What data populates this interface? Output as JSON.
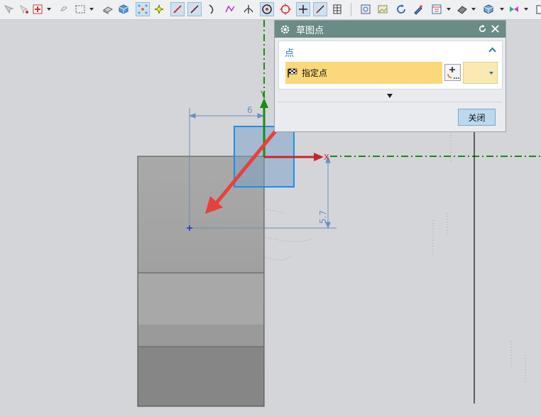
{
  "dialog": {
    "title": "草图点",
    "section_label": "点",
    "specify_point_label": "指定点",
    "close_label": "关闭"
  },
  "sketch": {
    "horizontal_dimension": "6",
    "vertical_dimension": "5.7",
    "x_axis_label": "X",
    "y_axis_label": "Y"
  },
  "colors": {
    "dialog_title_bar": "#6b8b86",
    "highlight_row": "#fcd87a",
    "datum_dashed_line": "#1a8a1a",
    "annotation_arrow": "#e8413a",
    "dimension_lines": "#6d8fbf",
    "selection_square": "#1d8fe8"
  },
  "toolbar_icons": [
    "move-icon",
    "snap-icon",
    "selection-filter-icon",
    "lasso-icon",
    "rectangle-select-icon",
    "part-icon",
    "cube-icon",
    "snap-points-icon",
    "snap-settings-icon",
    "line-icon",
    "line-icon",
    "curve-icon",
    "spline-icon",
    "intersection-icon",
    "circle-center-icon",
    "quadrant-icon",
    "point-on-curve-icon",
    "slope-icon",
    "table-icon",
    "view-fit-icon",
    "view-image-icon",
    "refresh-icon",
    "edit-icon",
    "layout-icon",
    "render-style-icon",
    "shaded-cube-icon",
    "orient-view-icon",
    "more-icon"
  ]
}
